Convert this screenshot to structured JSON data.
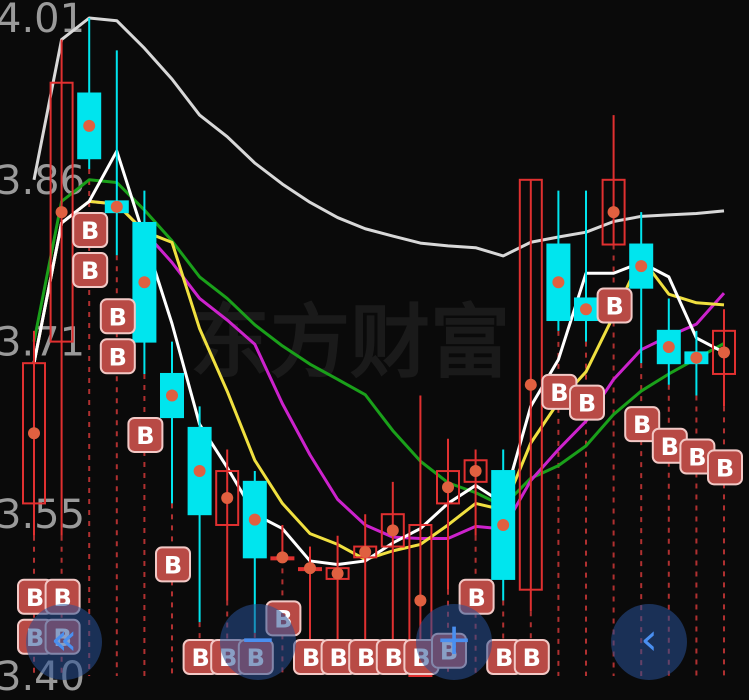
{
  "watermark": "东方财富",
  "chart_data": {
    "type": "candlestick",
    "ylim": [
      3.4,
      4.01
    ],
    "ytick_labels": [
      "4.01",
      "3.86",
      "3.71",
      "3.55",
      "3.40"
    ],
    "ytick_values": [
      4.01,
      3.86,
      3.71,
      3.55,
      3.4
    ],
    "colors": {
      "up": "#e03030",
      "down": "#00e5ee",
      "ma_white": "#ffffff",
      "ma_yellow": "#f0e040",
      "ma_magenta": "#cc22cc",
      "ma_green": "#1aa01a",
      "ma_gray": "#d8d8d8",
      "dot": "#e06040"
    },
    "candles": [
      {
        "open": 3.56,
        "close": 3.69,
        "high": 3.72,
        "low": 3.53
      },
      {
        "open": 3.71,
        "close": 3.95,
        "high": 3.99,
        "low": 3.53
      },
      {
        "open": 3.94,
        "close": 3.88,
        "high": 4.01,
        "low": 3.87
      },
      {
        "open": 3.84,
        "close": 3.83,
        "high": 3.98,
        "low": 3.79
      },
      {
        "open": 3.82,
        "close": 3.71,
        "high": 3.85,
        "low": 3.68
      },
      {
        "open": 3.68,
        "close": 3.64,
        "high": 3.71,
        "low": 3.56
      },
      {
        "open": 3.63,
        "close": 3.55,
        "high": 3.65,
        "low": 3.45
      },
      {
        "open": 3.54,
        "close": 3.59,
        "high": 3.61,
        "low": 3.47
      },
      {
        "open": 3.58,
        "close": 3.51,
        "high": 3.59,
        "low": 3.44
      },
      {
        "open": 3.51,
        "close": 3.51,
        "high": 3.54,
        "low": 3.51
      },
      {
        "open": 3.5,
        "close": 3.5,
        "high": 3.52,
        "low": 3.43
      },
      {
        "open": 3.49,
        "close": 3.5,
        "high": 3.53,
        "low": 3.43
      },
      {
        "open": 3.51,
        "close": 3.52,
        "high": 3.55,
        "low": 3.43
      },
      {
        "open": 3.52,
        "close": 3.55,
        "high": 3.58,
        "low": 3.41
      },
      {
        "open": 3.4,
        "close": 3.54,
        "high": 3.66,
        "low": 3.4
      },
      {
        "open": 3.56,
        "close": 3.59,
        "high": 3.62,
        "low": 3.48
      },
      {
        "open": 3.58,
        "close": 3.6,
        "high": 3.61,
        "low": 3.53
      },
      {
        "open": 3.59,
        "close": 3.49,
        "high": 3.61,
        "low": 3.47
      },
      {
        "open": 3.48,
        "close": 3.86,
        "high": 3.86,
        "low": 3.46
      },
      {
        "open": 3.8,
        "close": 3.73,
        "high": 3.85,
        "low": 3.72
      },
      {
        "open": 3.75,
        "close": 3.73,
        "high": 3.85,
        "low": 3.71
      },
      {
        "open": 3.8,
        "close": 3.86,
        "high": 3.92,
        "low": 3.8
      },
      {
        "open": 3.8,
        "close": 3.76,
        "high": 3.83,
        "low": 3.69
      },
      {
        "open": 3.72,
        "close": 3.69,
        "high": 3.75,
        "low": 3.67
      },
      {
        "open": 3.7,
        "close": 3.69,
        "high": 3.72,
        "low": 3.66
      },
      {
        "open": 3.68,
        "close": 3.72,
        "high": 3.74,
        "low": 3.65
      }
    ],
    "b_marks": [
      "B",
      "B",
      "B",
      "B",
      "B",
      "B",
      "B",
      "B",
      "B",
      "B",
      "B",
      "B",
      "B",
      "B",
      "B",
      "B",
      "B",
      "B",
      "B",
      "B",
      "B",
      "B",
      "B",
      "B",
      "B",
      "B",
      "B",
      "B",
      "B",
      "B"
    ]
  },
  "nav": {
    "rewind_icon": "«",
    "zoom_out_icon": "−",
    "zoom_in_icon": "+",
    "back_icon": "‹"
  }
}
